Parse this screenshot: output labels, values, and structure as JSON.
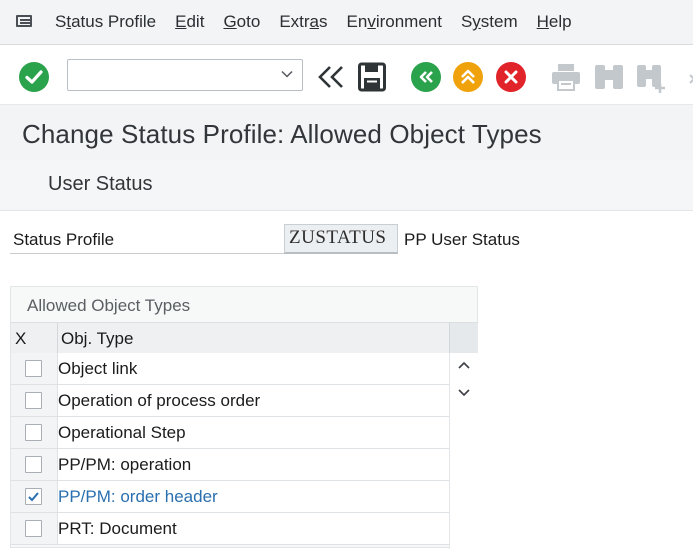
{
  "menu": {
    "items": [
      {
        "pre": "S",
        "ul": "t",
        "post": "atus Profile"
      },
      {
        "pre": "",
        "ul": "E",
        "post": "dit"
      },
      {
        "pre": "",
        "ul": "G",
        "post": "oto"
      },
      {
        "pre": "Extr",
        "ul": "a",
        "post": "s"
      },
      {
        "pre": "En",
        "ul": "v",
        "post": "ironment"
      },
      {
        "pre": "S",
        "ul": "y",
        "post": "stem"
      },
      {
        "pre": "",
        "ul": "H",
        "post": "elp"
      }
    ]
  },
  "toolbar": {
    "command_value": "",
    "icons": [
      "check-icon",
      "chevron-down-icon",
      "double-back-icon",
      "save-icon",
      "back-icon",
      "exit-icon",
      "cancel-icon",
      "print-icon",
      "find-icon",
      "find-next-icon"
    ],
    "colors": {
      "ok": "#2ba24c",
      "back": "#2ba24c",
      "exit": "#f0a20c",
      "cancel": "#e0242a",
      "disabled": "#c3c8cc"
    }
  },
  "page": {
    "title": "Change Status Profile: Allowed Object Types",
    "tab": "User Status"
  },
  "field": {
    "label": "Status Profile",
    "value": "ZUSTATUS",
    "description": "PP User Status"
  },
  "table": {
    "caption": "Allowed Object Types",
    "columns": {
      "x": "X",
      "type": "Obj. Type"
    },
    "rows": [
      {
        "label": "Object link",
        "checked": false
      },
      {
        "label": "Operation of process order",
        "checked": false
      },
      {
        "label": "Operational Step",
        "checked": false
      },
      {
        "label": "PP/PM: operation",
        "checked": false
      },
      {
        "label": "PP/PM: order header",
        "checked": true
      },
      {
        "label": "PRT: Document",
        "checked": false
      }
    ],
    "checked_text_color": "#2a6fb0"
  }
}
